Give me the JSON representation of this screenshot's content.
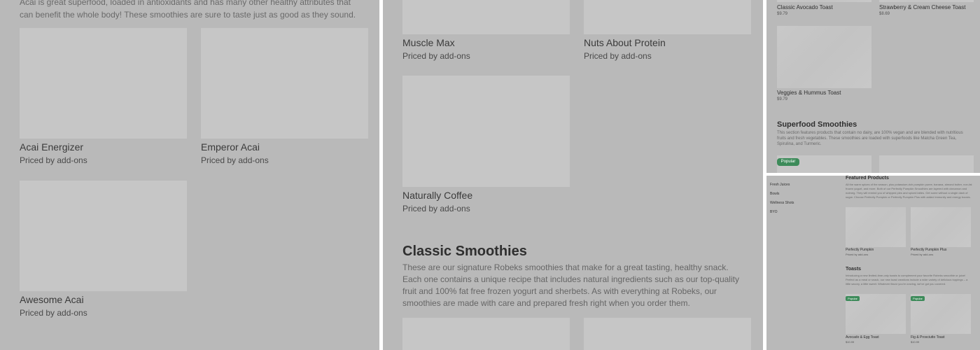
{
  "panel_a": {
    "intro": "Acai is great superfood, loaded in antioxidants and has many other healthy attributes that can benefit the whole body! These smoothies are sure to taste just as good as they sound.",
    "products": [
      {
        "name": "Acai Energizer",
        "price": "Priced by add-ons"
      },
      {
        "name": "Emperor Acai",
        "price": "Priced by add-ons"
      },
      {
        "name": "Awesome Acai",
        "price": "Priced by add-ons"
      }
    ]
  },
  "panel_b": {
    "products_top": [
      {
        "name": "Muscle Max",
        "price": "Priced by add-ons"
      },
      {
        "name": "Nuts About Protein",
        "price": "Priced by add-ons"
      },
      {
        "name": "Naturally Coffee",
        "price": "Priced by add-ons"
      }
    ],
    "section": {
      "title": "Classic Smoothies",
      "description": "These are our signature Robeks smoothies that make for a great tasting, healthy snack. Each one contains a unique recipe that includes natural ingredients such as our top-quality fruit and 100% fat free frozen yogurt and sherbets. As with everything at Robeks, our smoothies are made with care and prepared fresh right when you order them."
    }
  },
  "panel_c": {
    "toasts": [
      {
        "name": "Classic Avocado Toast",
        "price": "$9.79"
      },
      {
        "name": "Strawberry & Cream Cheese Toast",
        "price": "$8.69"
      },
      {
        "name": "Veggies & Hummus Toast",
        "price": "$9.79"
      }
    ],
    "section": {
      "title": "Superfood Smoothies",
      "description": "This section features products that contain no dairy, are 100% vegan and are blended with nutritious fruits and fresh vegetables. These smoothies are loaded with superfoods like Matcha Green Tea, Spirulina, and Turmeric."
    },
    "badge": "Popular"
  },
  "panel_d": {
    "nav": [
      "Fresh Juices",
      "Bowls",
      "Wellness Shots",
      "BYO"
    ],
    "featured": {
      "title": "Featured Products",
      "description": "All the warm spices of the season, plus potassium-rich pumpkin puree, banana, almond butter, non-fat frozen yogurt, and more. Both of our Perfectly Pumpkin Smoothies are layered with cinnamon and nutmeg. They will remind you of whipped pies and spiced lattes. Get some without a single dash of sugar. Choose Perfectly Pumpkin or Perfectly Pumpkin Plus with added immunity and energy boosts.",
      "products": [
        {
          "name": "Perfectly Pumpkin",
          "price": "Priced by add-ons"
        },
        {
          "name": "Perfectly Pumpkin Plus",
          "price": "Priced by add-ons"
        }
      ]
    },
    "toasts": {
      "title": "Toasts",
      "description": "Introducing a new limited-time-only toasts to complement your favorite Robeks smoothie or juice! Perfect as a meal or snack, our new toast creations include a wide variety of delicious toppings – a little savory, a little sweet. Whatever flavor you're craving, we've got you covered.",
      "badge": "Popular",
      "products": [
        {
          "name": "Avocado & Egg Toast",
          "price": "$10.99"
        },
        {
          "name": "Fig & Prosciutto Toast",
          "price": "$10.99"
        }
      ]
    }
  }
}
